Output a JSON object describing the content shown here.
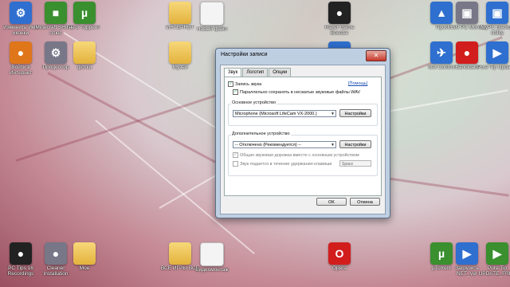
{
  "desktop_icons": [
    {
      "label": "Изменить Имя иконки",
      "style": "blue",
      "glyph": "⚙"
    },
    {
      "label": "Minecraft SHIFT - плюс",
      "style": "green",
      "glyph": "■"
    },
    {
      "label": "не 3 Торрент",
      "style": "green",
      "glyph": "µ"
    },
    {
      "label": "ИНТЕРНЕТ",
      "style": "folder",
      "glyph": ""
    },
    {
      "label": "Новый файл",
      "style": "doc",
      "glyph": ""
    },
    {
      "label": "Razer Game Booster",
      "style": "dark",
      "glyph": "●"
    },
    {
      "label": "Пуск",
      "style": "blue",
      "glyph": "▲"
    },
    {
      "label": "MSN РС Monitor",
      "style": "gray",
      "glyph": "▣"
    },
    {
      "label": "MyPC Backup Utility",
      "style": "blue",
      "glyph": "▣"
    },
    {
      "label": "Войти в Интернет",
      "style": "orange",
      "glyph": "●"
    },
    {
      "label": "Процессор",
      "style": "gray",
      "glyph": "⚙"
    },
    {
      "label": "фотки",
      "style": "folder",
      "glyph": ""
    },
    {
      "label": "Музей",
      "style": "folder",
      "glyph": ""
    },
    {
      "label": "QuickTime",
      "style": "blue",
      "glyph": "Q"
    },
    {
      "label": "Get Control",
      "style": "blue",
      "glyph": "✈"
    },
    {
      "label": "Bandicam",
      "style": "red",
      "glyph": "●"
    },
    {
      "label": "Pure Tip Updates",
      "style": "blue",
      "glyph": "▶"
    },
    {
      "label": "PC Tips 16 Recordings",
      "style": "dark",
      "glyph": "●"
    },
    {
      "label": "Cleaner Installation",
      "style": "gray",
      "glyph": "●"
    },
    {
      "label": "Мое",
      "style": "folder",
      "glyph": ""
    },
    {
      "label": "ВСЕ ИГРЫ ВСЕ",
      "style": "folder",
      "glyph": ""
    },
    {
      "label": "Видеомонтаж",
      "style": "doc",
      "glyph": ""
    },
    {
      "label": "Opera",
      "style": "red",
      "glyph": "O"
    },
    {
      "label": "µTorrent",
      "style": "green",
      "glyph": "µ"
    },
    {
      "label": "Загрузить NET_Ver",
      "style": "blue",
      "glyph": "▶"
    },
    {
      "label": "Pure Tip UPDATE_FREE",
      "style": "green",
      "glyph": "▶"
    }
  ],
  "dialog": {
    "title": "Настройки записи",
    "close_glyph": "✕",
    "tabs": [
      "Звук",
      "Логотип",
      "Опции"
    ],
    "record_audio_label": "Запись звука",
    "help_link": "[Помощь]",
    "save_wav_label": "Параллельно сохранять в несжатые звуковые файлы WAV",
    "primary_device_group": "Основное устройство",
    "primary_device_value": "Microphone (Microsoft LifeCam VX-2000.)",
    "settings_button": "Настройки",
    "secondary_device_group": "Дополнительное устройство",
    "secondary_device_value": "-- Отключено (Рекомендуется) --",
    "settings_button_2": "Настройки",
    "mix_label": "Общая звуковая дорожка вместе с основным устройством",
    "hold_key_label": "Звук подается в течение удержания клавиши",
    "hold_key_value": "Space",
    "ok_button": "OK",
    "cancel_button": "Отмена"
  }
}
